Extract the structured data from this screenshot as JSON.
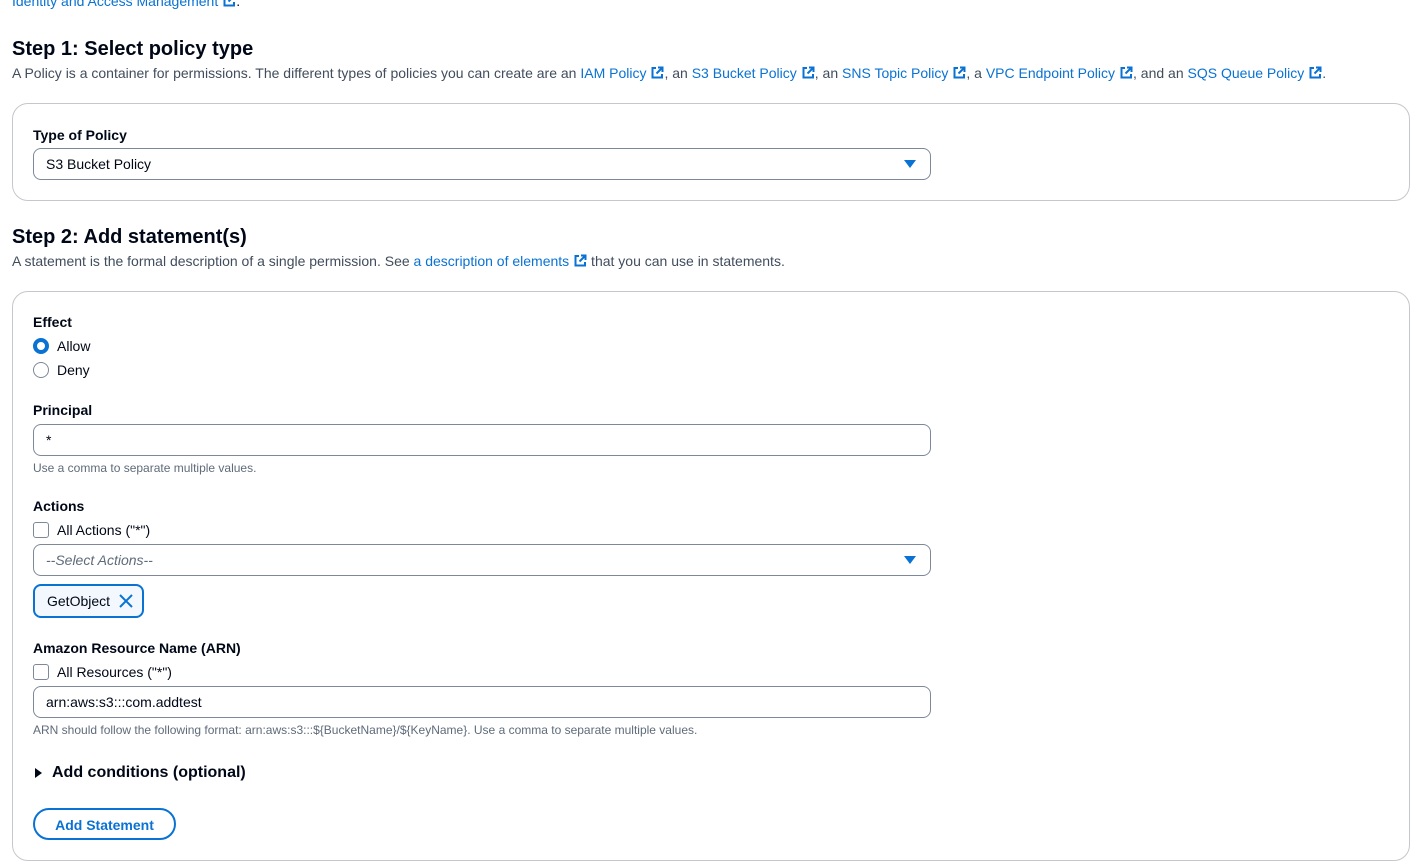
{
  "header": {
    "top_link_text": "Identity and Access Management",
    "top_link_suffix": "."
  },
  "step1": {
    "title": "Step 1: Select policy type",
    "desc_prefix": "A Policy is a container for permissions. The different types of policies you can create are an ",
    "links": [
      "IAM Policy",
      "S3 Bucket Policy",
      "SNS Topic Policy",
      "VPC Endpoint Policy",
      "SQS Queue Policy"
    ],
    "separators": [
      ", an ",
      ", an ",
      ", a ",
      ", and an ",
      "."
    ],
    "type_label": "Type of Policy",
    "type_value": "S3 Bucket Policy"
  },
  "step2": {
    "title": "Step 2: Add statement(s)",
    "desc_prefix": "A statement is the formal description of a single permission. See ",
    "desc_link": "a description of elements",
    "desc_suffix": " that you can use in statements.",
    "effect_label": "Effect",
    "effect_options": [
      "Allow",
      "Deny"
    ],
    "effect_selected": "Allow",
    "principal_label": "Principal",
    "principal_value": "*",
    "principal_help": "Use a comma to separate multiple values.",
    "actions_label": "Actions",
    "all_actions_label": "All Actions (\"*\")",
    "actions_placeholder": "--Select Actions--",
    "selected_actions": [
      "GetObject"
    ],
    "arn_label": "Amazon Resource Name (ARN)",
    "all_resources_label": "All Resources (\"*\")",
    "arn_value": "arn:aws:s3:::com.addtest",
    "arn_help": "ARN should follow the following format: arn:aws:s3:::${BucketName}/${KeyName}. Use a comma to separate multiple values.",
    "conditions_label": "Add conditions (optional)",
    "add_statement_label": "Add Statement"
  },
  "colors": {
    "accent": "#0972d3",
    "text": "#000716",
    "secondary_text": "#5f6b7a",
    "border": "#7d8998"
  },
  "icons": {
    "external_link": "external-link-icon",
    "dropdown": "caret-down-icon",
    "remove_token": "close-icon",
    "expand": "caret-right-icon"
  }
}
